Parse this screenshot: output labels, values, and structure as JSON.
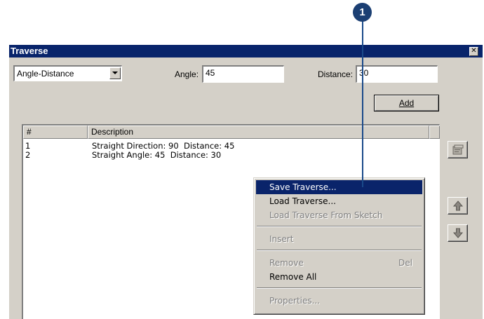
{
  "callout": {
    "number": "1"
  },
  "window": {
    "title": "Traverse",
    "close_glyph": "✕"
  },
  "toolbar": {
    "mode_select": {
      "value": "Angle-Distance"
    },
    "angle": {
      "label": "Angle:",
      "value": "45"
    },
    "distance": {
      "label": "Distance:",
      "value": "30"
    },
    "add_button": {
      "label": "Add"
    }
  },
  "list": {
    "columns": [
      "#",
      "Description"
    ],
    "rows": [
      {
        "num": "1",
        "desc": "Straight Direction: 90  Distance: 45"
      },
      {
        "num": "2",
        "desc": "Straight Angle: 45  Distance: 30"
      }
    ]
  },
  "side_buttons": {
    "properties_icon": "properties-icon",
    "up_icon": "up-arrow-icon",
    "down_icon": "down-arrow-icon"
  },
  "context_menu": {
    "items": [
      {
        "label": "Save Traverse...",
        "state": "highlighted"
      },
      {
        "label": "Load Traverse...",
        "state": "enabled"
      },
      {
        "label": "Load Traverse From Sketch",
        "state": "disabled"
      },
      {
        "label": "Insert",
        "state": "disabled"
      },
      {
        "label": "Remove",
        "shortcut": "Del",
        "state": "disabled"
      },
      {
        "label": "Remove All",
        "state": "enabled"
      },
      {
        "label": "Properties...",
        "state": "disabled"
      }
    ]
  },
  "colors": {
    "titlebar": "#08246b",
    "highlight": "#0a246a",
    "face": "#d4d0c8",
    "callout": "#1b3f73"
  }
}
